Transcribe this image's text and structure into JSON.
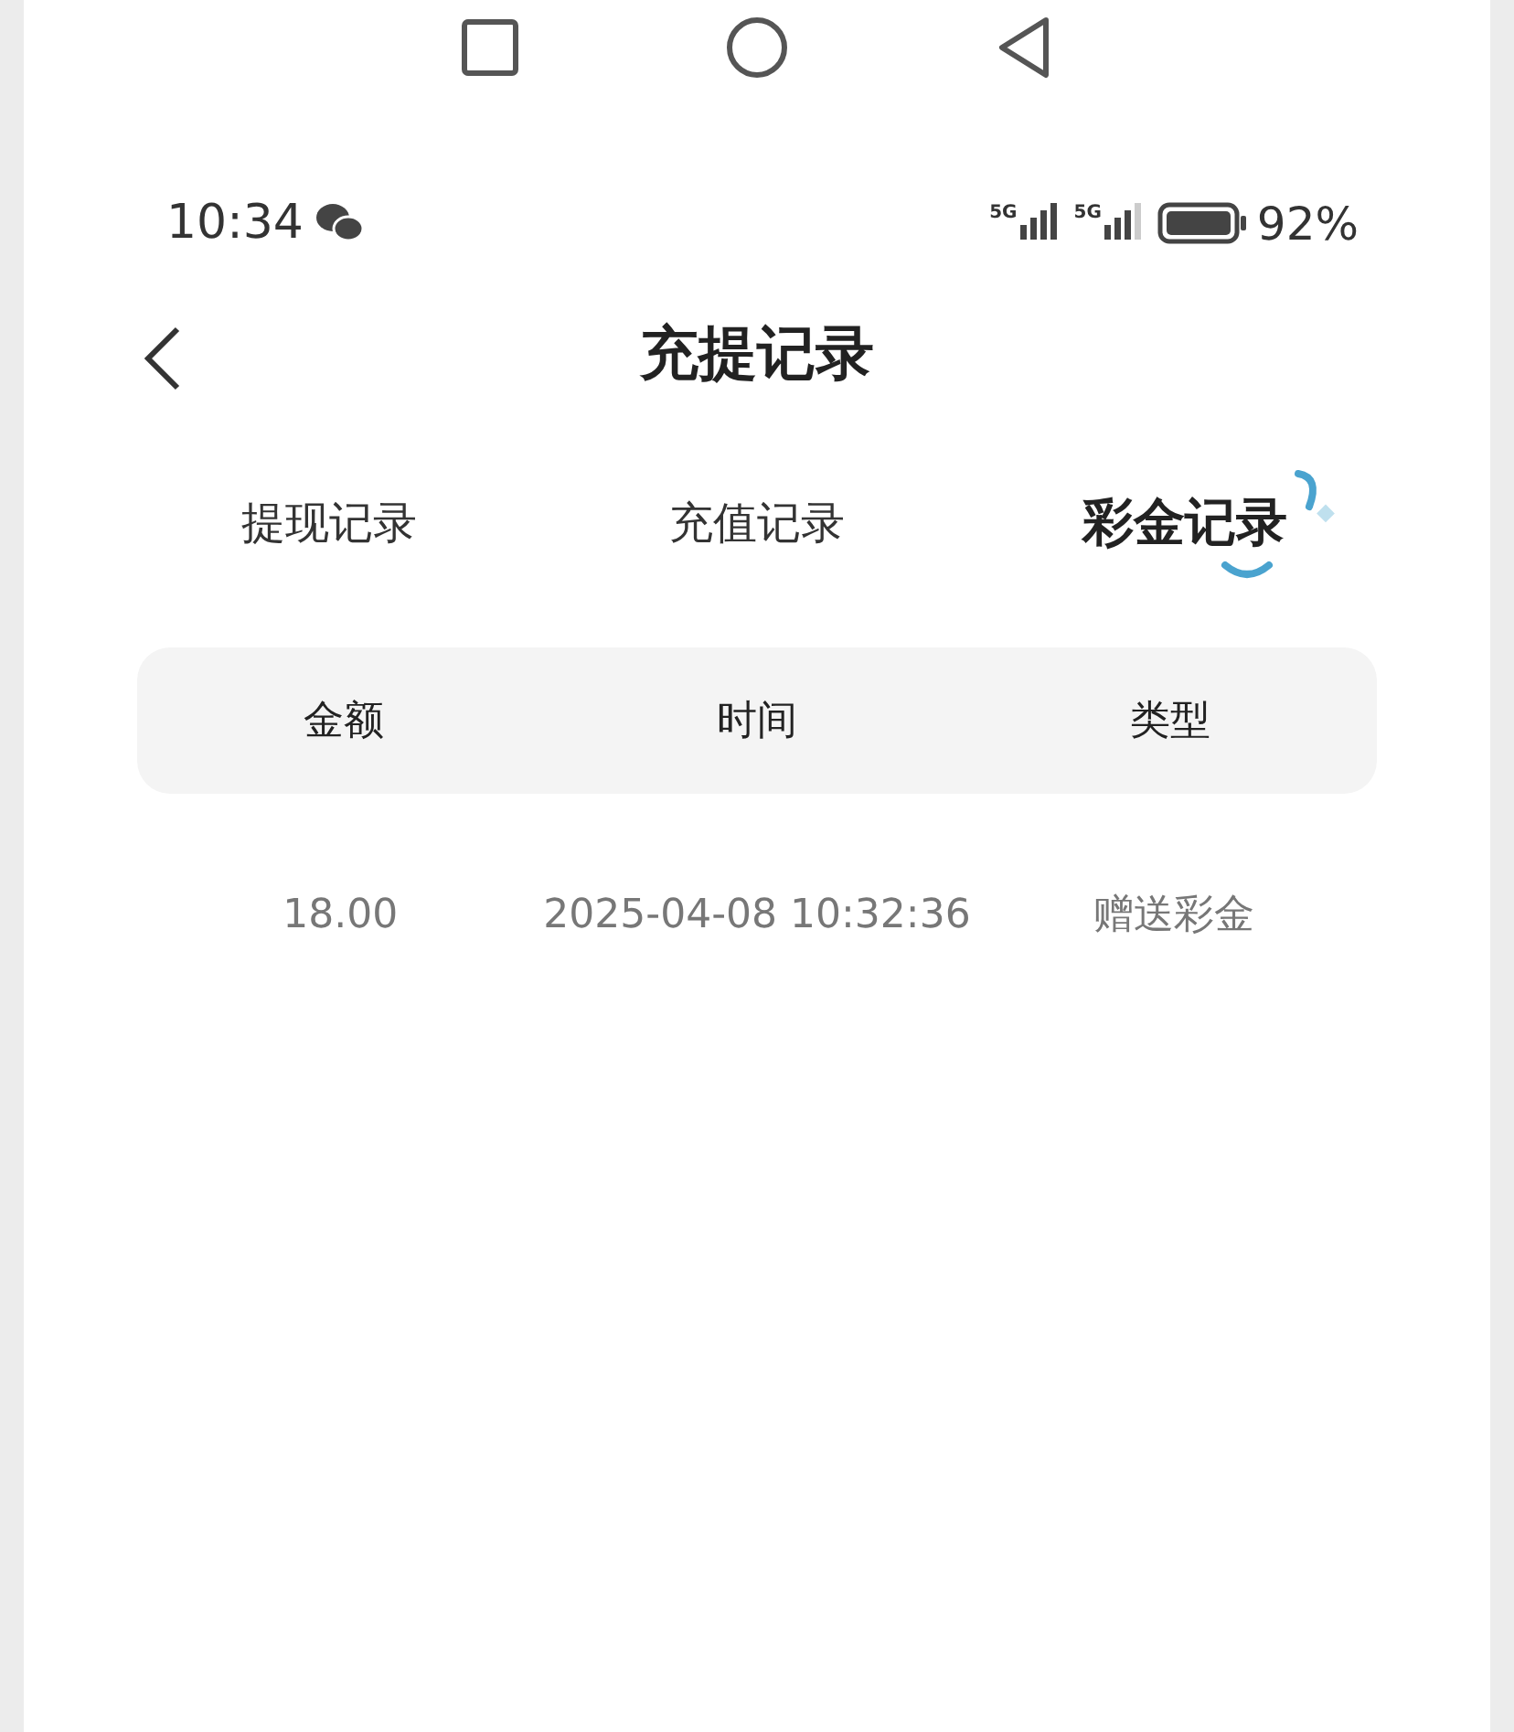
{
  "status_bar": {
    "time": "10:34",
    "signals": [
      {
        "label": "5G"
      },
      {
        "label": "5G"
      }
    ],
    "battery_percent": "92%"
  },
  "header": {
    "title": "充提记录"
  },
  "tabs": [
    {
      "label": "提现记录",
      "selected": false
    },
    {
      "label": "充值记录",
      "selected": false
    },
    {
      "label": "彩金记录",
      "selected": true
    }
  ],
  "table": {
    "columns": [
      "金额",
      "时间",
      "类型"
    ],
    "rows": [
      [
        "18.00",
        "2025-04-08 10:32:36",
        "赠送彩金"
      ]
    ]
  }
}
